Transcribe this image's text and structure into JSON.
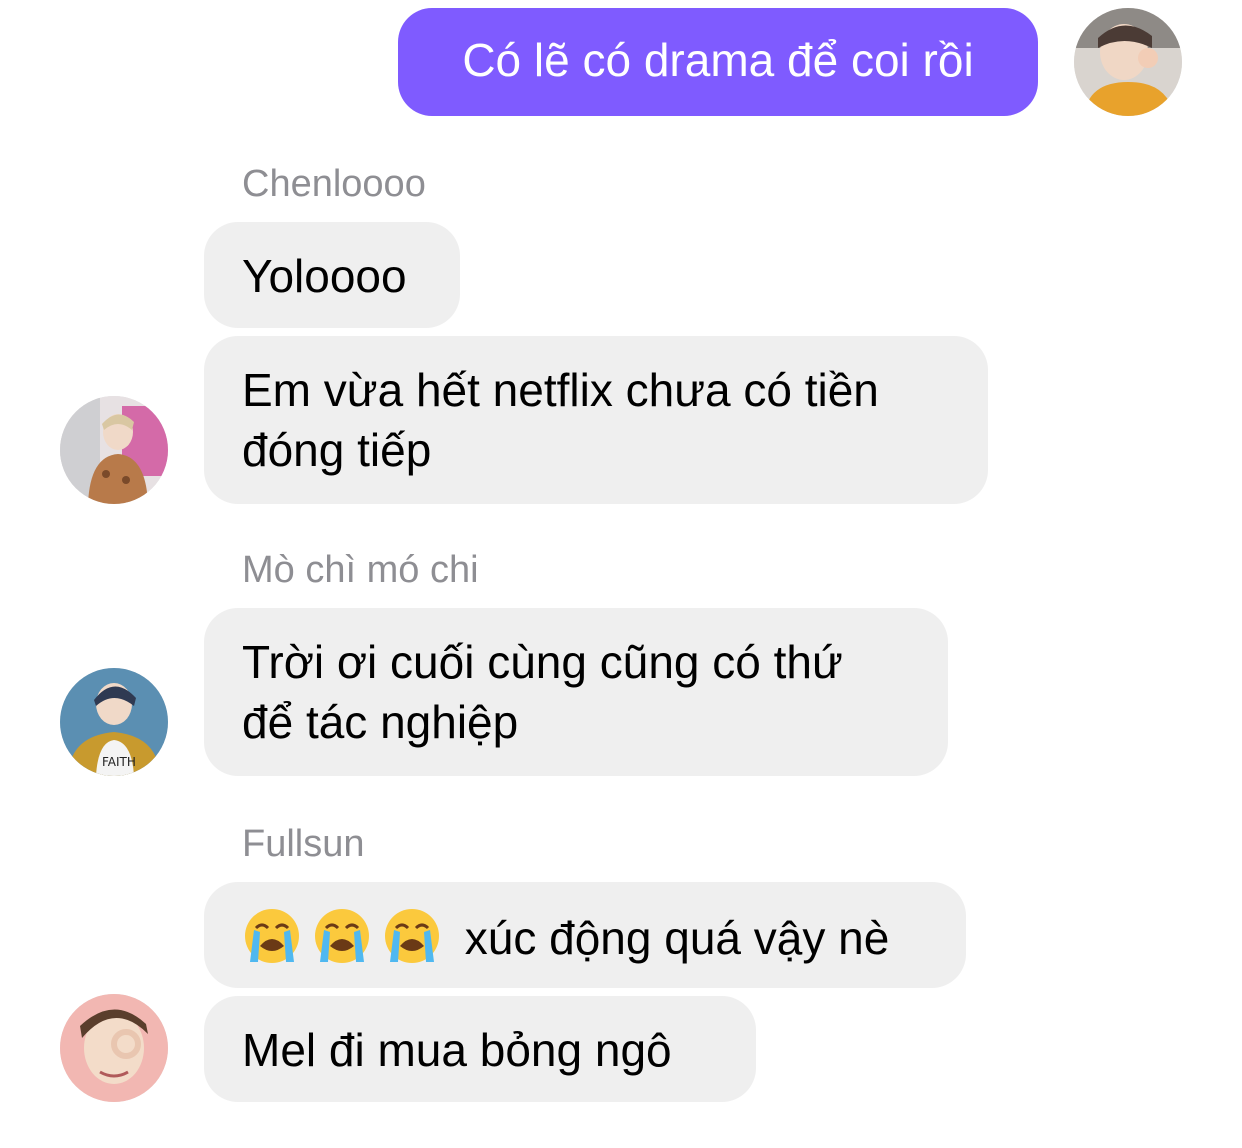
{
  "outgoing": {
    "text": "Có lẽ có drama để coi rồi"
  },
  "groups": [
    {
      "sender": "Chenloooo",
      "messages": [
        "Yoloooo",
        "Em vừa hết netflix chưa có tiền",
        "đóng tiếp"
      ]
    },
    {
      "sender": "Mò chì mó chi",
      "messages": [
        "Trời ơi cuối cùng cũng có thứ",
        "để tác nghiệp"
      ]
    },
    {
      "sender": "Fullsun",
      "messages": [
        "xúc động quá vậy nè",
        "Mel đi mua bỏng ngô"
      ]
    }
  ],
  "icons": {
    "emoji": "loudly-crying-face-icon"
  },
  "colors": {
    "outgoing_bubble": "#7f5bff",
    "incoming_bubble": "#efefef",
    "sender_name": "#8e8e93"
  }
}
